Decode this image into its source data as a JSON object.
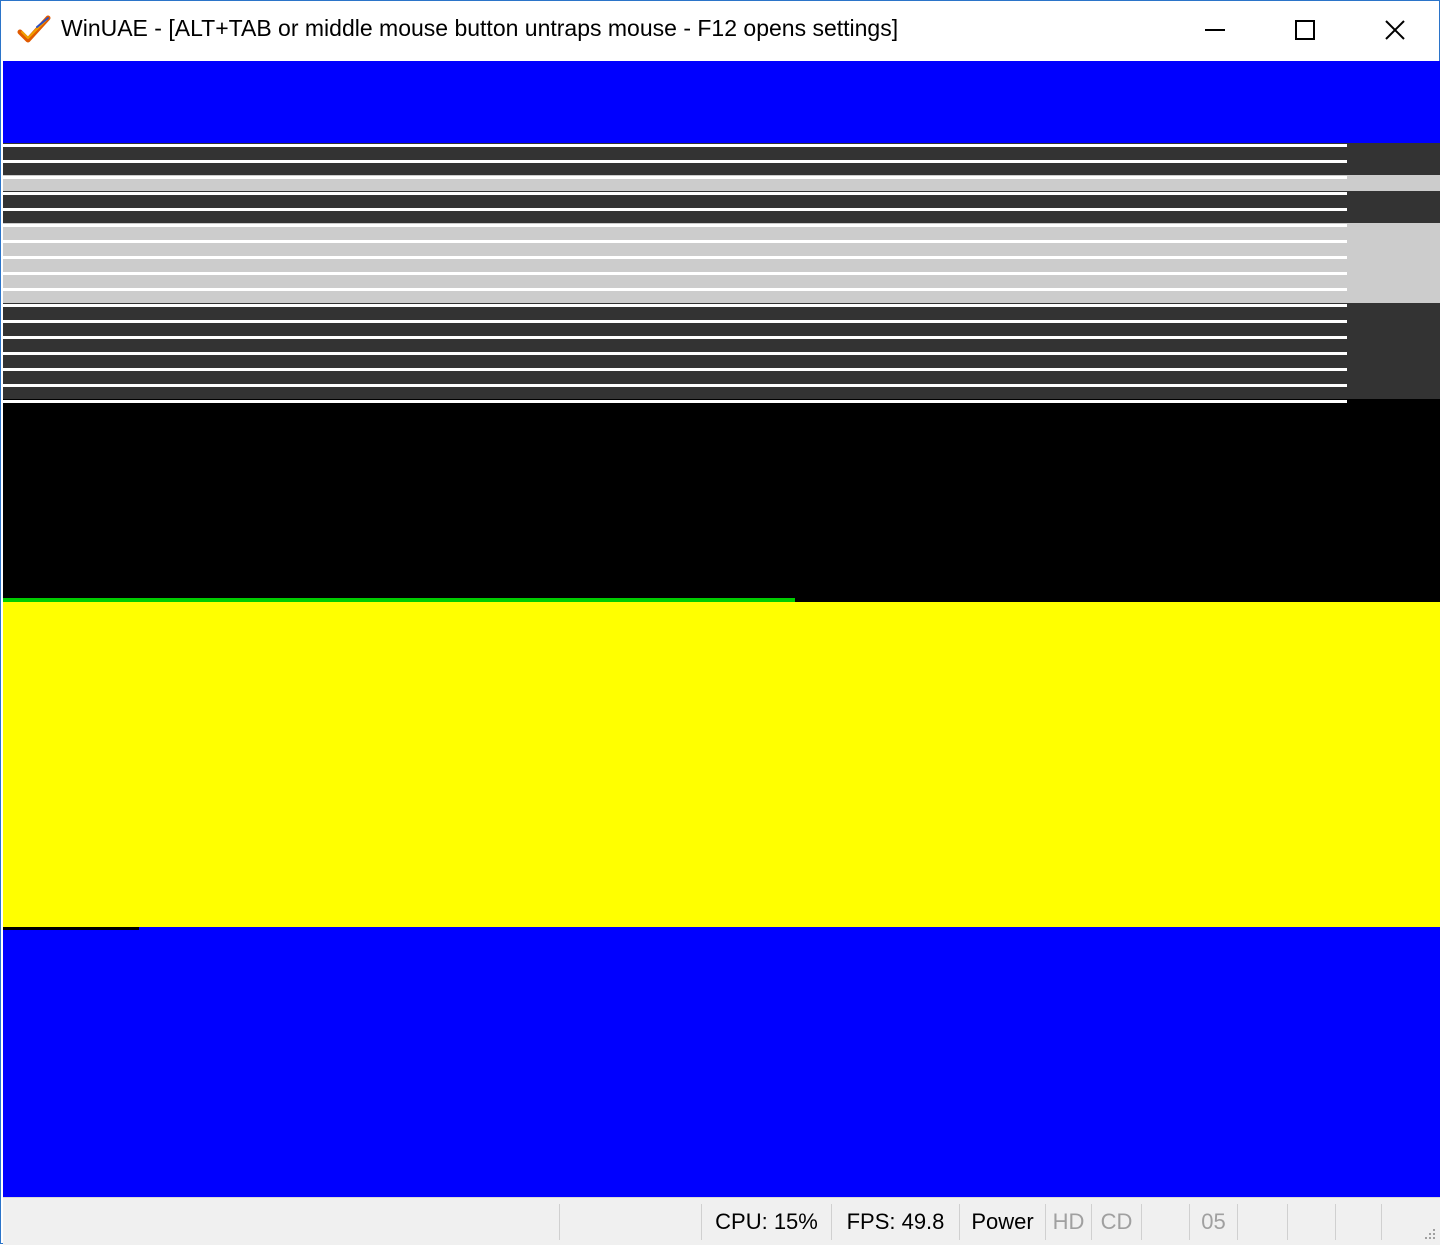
{
  "window": {
    "title": "WinUAE - [ALT+TAB or middle mouse button untraps mouse - F12 opens settings]",
    "icons": [
      "winuae-checkmark-icon",
      "minimize-icon",
      "maximize-icon",
      "close-icon"
    ]
  },
  "colors": {
    "blue": "#0000ff",
    "yellow": "#ffff00",
    "black": "#000000",
    "dark_gray": "#333333",
    "light_gray": "#cccccc",
    "green": "#00cc00"
  },
  "status_bar": {
    "cpu": "CPU: 15%",
    "fps": "FPS: 49.8",
    "power": "Power",
    "hd": "HD",
    "cd": "CD",
    "drive": "05"
  }
}
